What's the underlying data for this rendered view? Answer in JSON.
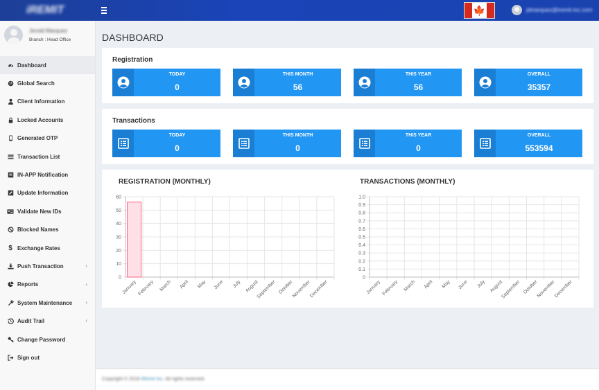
{
  "header": {
    "logo_text": "iREMIT",
    "user_email": "jdmarquez@iremit-inc.com"
  },
  "profile": {
    "name": "Jerold Marquez",
    "branch": "Branch : Head Office"
  },
  "sidebar": {
    "items": [
      {
        "label": "Dashboard",
        "icon": "dashboard-icon"
      },
      {
        "label": "Global Search",
        "icon": "globe-icon"
      },
      {
        "label": "Client Information",
        "icon": "user-icon"
      },
      {
        "label": "Locked Accounts",
        "icon": "lock-icon"
      },
      {
        "label": "Generated OTP",
        "icon": "mobile-icon"
      },
      {
        "label": "Transaction List",
        "icon": "list-icon"
      },
      {
        "label": "IN-APP Notification",
        "icon": "notification-icon"
      },
      {
        "label": "Update Information",
        "icon": "edit-icon"
      },
      {
        "label": "Validate New IDs",
        "icon": "id-card-icon"
      },
      {
        "label": "Blocked Names",
        "icon": "ban-icon"
      },
      {
        "label": "Exchange Rates",
        "icon": "dollar-icon"
      },
      {
        "label": "Push Transaction",
        "icon": "download-icon"
      },
      {
        "label": "Reports",
        "icon": "pie-chart-icon"
      },
      {
        "label": "System Maintenance",
        "icon": "wrench-icon"
      },
      {
        "label": "Audit Trail",
        "icon": "history-icon"
      },
      {
        "label": "Change Password",
        "icon": "key-icon"
      },
      {
        "label": "Sign out",
        "icon": "sign-out-icon"
      }
    ]
  },
  "main": {
    "page_title": "DASHBOARD",
    "registration": {
      "title": "Registration",
      "stats": [
        {
          "label": "TODAY",
          "value": "0"
        },
        {
          "label": "THIS MONTH",
          "value": "56"
        },
        {
          "label": "THIS YEAR",
          "value": "56"
        },
        {
          "label": "OVERALL",
          "value": "35357"
        }
      ]
    },
    "transactions": {
      "title": "Transactions",
      "stats": [
        {
          "label": "TODAY",
          "value": "0"
        },
        {
          "label": "THIS MONTH",
          "value": "0"
        },
        {
          "label": "THIS YEAR",
          "value": "0"
        },
        {
          "label": "OVERALL",
          "value": "553594"
        }
      ]
    }
  },
  "footer": {
    "copyright": "Copyright © 2019",
    "company": "iRemit Inc.",
    "rights": "All rights reserved."
  },
  "chart_data": [
    {
      "type": "bar",
      "title": "REGISTRATION (MONTHLY)",
      "categories": [
        "January",
        "February",
        "March",
        "April",
        "May",
        "June",
        "July",
        "August",
        "September",
        "October",
        "November",
        "December"
      ],
      "values": [
        56,
        0,
        0,
        0,
        0,
        0,
        0,
        0,
        0,
        0,
        0,
        0
      ],
      "ylim": [
        0,
        60
      ],
      "yticks": [
        "0",
        "10",
        "20",
        "30",
        "40",
        "50",
        "60"
      ],
      "grid": true,
      "bar_color": "#ffe0e6",
      "bar_border": "#ff6384"
    },
    {
      "type": "bar",
      "title": "TRANSACTIONS (MONTHLY)",
      "categories": [
        "January",
        "February",
        "March",
        "April",
        "May",
        "June",
        "July",
        "August",
        "September",
        "October",
        "November",
        "December"
      ],
      "values": [
        0,
        0,
        0,
        0,
        0,
        0,
        0,
        0,
        0,
        0,
        0,
        0
      ],
      "ylim": [
        0,
        1
      ],
      "yticks": [
        "0",
        "0.1",
        "0.2",
        "0.3",
        "0.4",
        "0.5",
        "0.6",
        "0.7",
        "0.8",
        "0.9",
        "1.0"
      ],
      "grid": true,
      "bar_color": "#ffe0e6",
      "bar_border": "#ff6384"
    }
  ]
}
